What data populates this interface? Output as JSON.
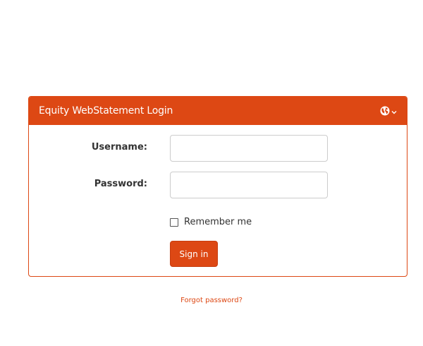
{
  "panel": {
    "title": "Equity WebStatement Login",
    "language_icon": "globe-icon"
  },
  "form": {
    "username_label": "Username:",
    "username_value": "",
    "password_label": "Password:",
    "password_value": "",
    "remember_label": "Remember me",
    "remember_checked": false,
    "signin_label": "Sign in"
  },
  "footer": {
    "forgot_password": "Forgot password?"
  },
  "colors": {
    "accent": "#dd4814",
    "panel_border": "#dd4814",
    "input_border": "#cccccc"
  }
}
